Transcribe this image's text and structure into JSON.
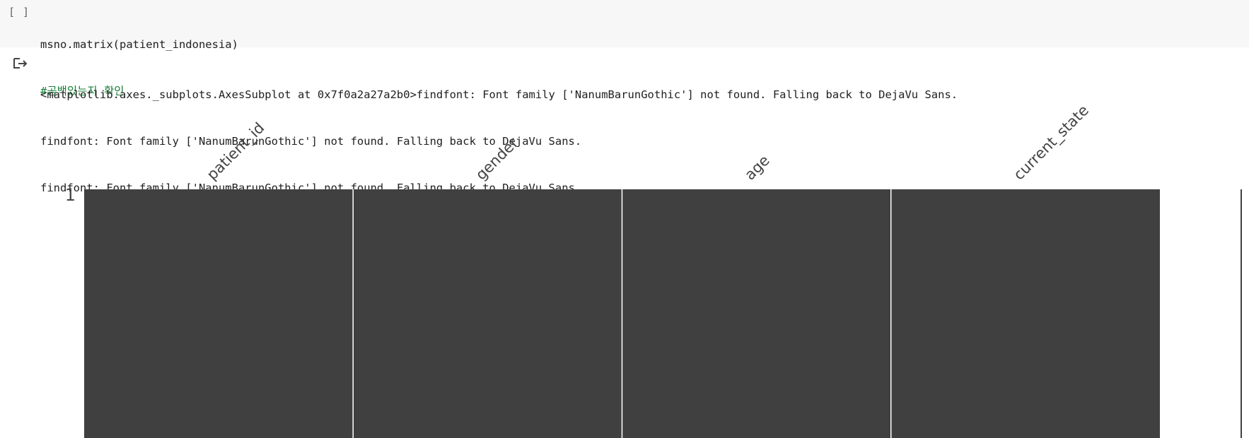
{
  "cell": {
    "run_indicator": "[ ]",
    "code_lines": [
      "msno.matrix(patient_indonesia)",
      "#공백있는지 확인"
    ]
  },
  "output": {
    "icon": "output-redirect-icon",
    "lines": [
      "<matplotlib.axes._subplots.AxesSubplot at 0x7f0a2a27a2b0>findfont: Font family ['NanumBarunGothic'] not found. Falling back to DejaVu Sans.",
      "findfont: Font family ['NanumBarunGothic'] not found. Falling back to DejaVu Sans.",
      "findfont: Font family ['NanumBarunGothic'] not found. Falling back to DejaVu Sans."
    ]
  },
  "chart_data": {
    "type": "heatmap",
    "columns": [
      "patient_id",
      "gender",
      "age",
      "current_state"
    ],
    "row_labels": [
      "1"
    ],
    "completeness": [
      1,
      1,
      1,
      1
    ],
    "colors": {
      "filled": "#404040",
      "separator": "#ffffff",
      "label": "#444444"
    }
  }
}
